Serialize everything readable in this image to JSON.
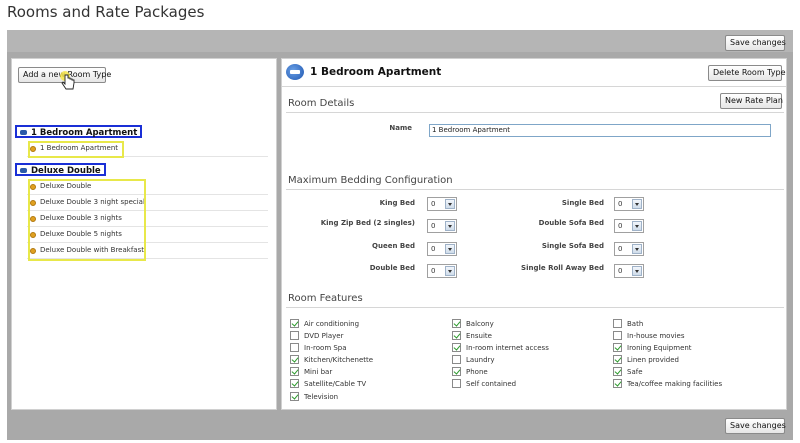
{
  "page": {
    "title": "Rooms and Rate Packages"
  },
  "toolbar": {
    "save_label": "Save changes"
  },
  "left": {
    "add_label": "Add a new Room Type",
    "groups": [
      {
        "label": "1 Bedroom Apartment",
        "items": [
          "1 Bedroom Apartment"
        ]
      },
      {
        "label": "Deluxe Double",
        "items": [
          "Deluxe Double",
          "Deluxe Double 3 night special",
          "Deluxe Double 3 nights",
          "Deluxe Double 5 nights",
          "Deluxe Double with Breakfast"
        ]
      }
    ]
  },
  "room": {
    "title": "1 Bedroom Apartment",
    "delete_label": "Delete Room Type",
    "new_rate_label": "New Rate Plan",
    "details_title": "Room Details",
    "name_label": "Name",
    "name_value": "1 Bedroom Apartment",
    "bedding_title": "Maximum Bedding Configuration",
    "bedding": [
      {
        "label": "King Bed",
        "value": "0"
      },
      {
        "label": "Single Bed",
        "value": "0"
      },
      {
        "label": "King Zip Bed (2 singles)",
        "value": "0"
      },
      {
        "label": "Double Sofa Bed",
        "value": "0"
      },
      {
        "label": "Queen Bed",
        "value": "0"
      },
      {
        "label": "Single Sofa Bed",
        "value": "0"
      },
      {
        "label": "Double Bed",
        "value": "0"
      },
      {
        "label": "Single Roll Away Bed",
        "value": "0"
      }
    ],
    "features_title": "Room Features",
    "features": [
      {
        "label": "Air conditioning",
        "checked": true
      },
      {
        "label": "DVD Player",
        "checked": false
      },
      {
        "label": "In-room Spa",
        "checked": false
      },
      {
        "label": "Kitchen/Kitchenette",
        "checked": true
      },
      {
        "label": "Mini bar",
        "checked": true
      },
      {
        "label": "Satellite/Cable TV",
        "checked": true
      },
      {
        "label": "Television",
        "checked": true
      },
      {
        "label": "Balcony",
        "checked": true
      },
      {
        "label": "Ensuite",
        "checked": true
      },
      {
        "label": "In-room internet access",
        "checked": true
      },
      {
        "label": "Laundry",
        "checked": false
      },
      {
        "label": "Phone",
        "checked": true
      },
      {
        "label": "Self contained",
        "checked": false
      },
      {
        "label": "Bath",
        "checked": false
      },
      {
        "label": "In-house movies",
        "checked": false
      },
      {
        "label": "Ironing Equipment",
        "checked": true
      },
      {
        "label": "Linen provided",
        "checked": true
      },
      {
        "label": "Safe",
        "checked": true
      },
      {
        "label": "Tea/coffee making facilities",
        "checked": true
      }
    ]
  }
}
